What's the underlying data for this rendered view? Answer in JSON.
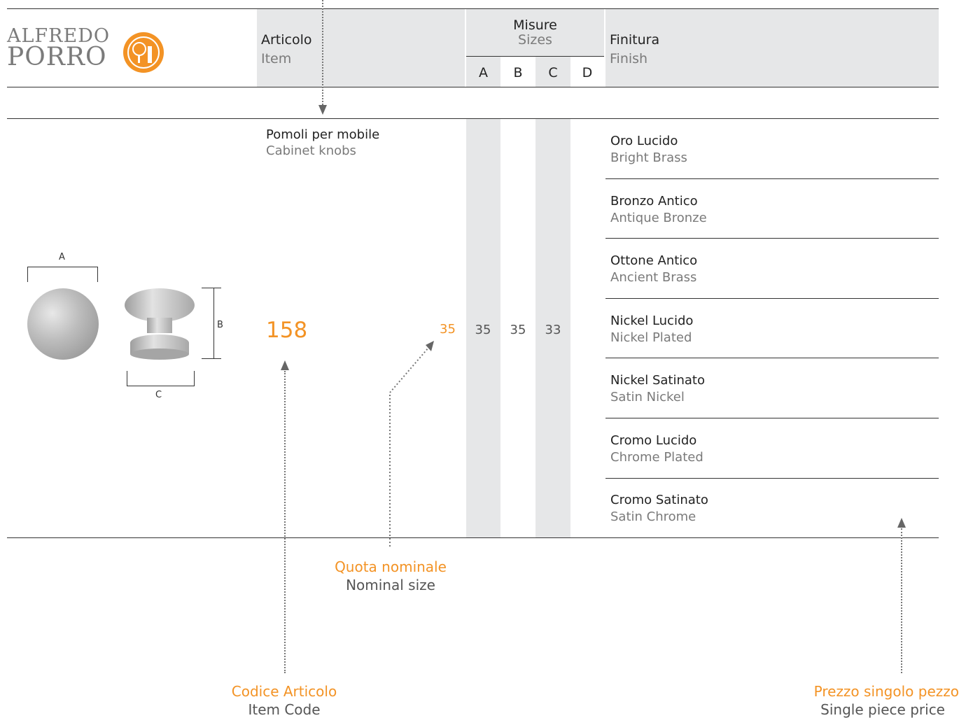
{
  "brand": {
    "line1": "ALFREDO",
    "line2": "PORRO"
  },
  "header": {
    "item_it": "Articolo",
    "item_en": "Item",
    "sizes_it": "Misure",
    "sizes_en": "Sizes",
    "size_cols": [
      "A",
      "B",
      "C",
      "D"
    ],
    "finish_it": "Finitura",
    "finish_en": "Finish"
  },
  "product": {
    "type_it": "Pomoli per mobile",
    "type_en": "Cabinet knobs",
    "code": "158",
    "nominal_size": "35",
    "sizes": {
      "A": "35",
      "B": "35",
      "C": "33",
      "D": ""
    },
    "dims": {
      "a": "A",
      "b": "B",
      "c": "C"
    }
  },
  "finishes": [
    {
      "it": "Oro Lucido",
      "en": "Bright Brass"
    },
    {
      "it": "Bronzo Antico",
      "en": "Antique Bronze"
    },
    {
      "it": "Ottone Antico",
      "en": "Ancient Brass"
    },
    {
      "it": "Nickel Lucido",
      "en": "Nickel Plated"
    },
    {
      "it": "Nickel Satinato",
      "en": "Satin Nickel"
    },
    {
      "it": "Cromo Lucido",
      "en": "Chrome Plated"
    },
    {
      "it": "Cromo Satinato",
      "en": "Satin Chrome"
    }
  ],
  "notes": {
    "nominal_it": "Quota nominale",
    "nominal_en": "Nominal size",
    "code_it": "Codice Articolo",
    "code_en": "Item Code",
    "price_it": "Prezzo singolo pezzo",
    "price_en": "Single piece price"
  },
  "colors": {
    "accent": "#f39325",
    "band": "#e6e7e8"
  }
}
